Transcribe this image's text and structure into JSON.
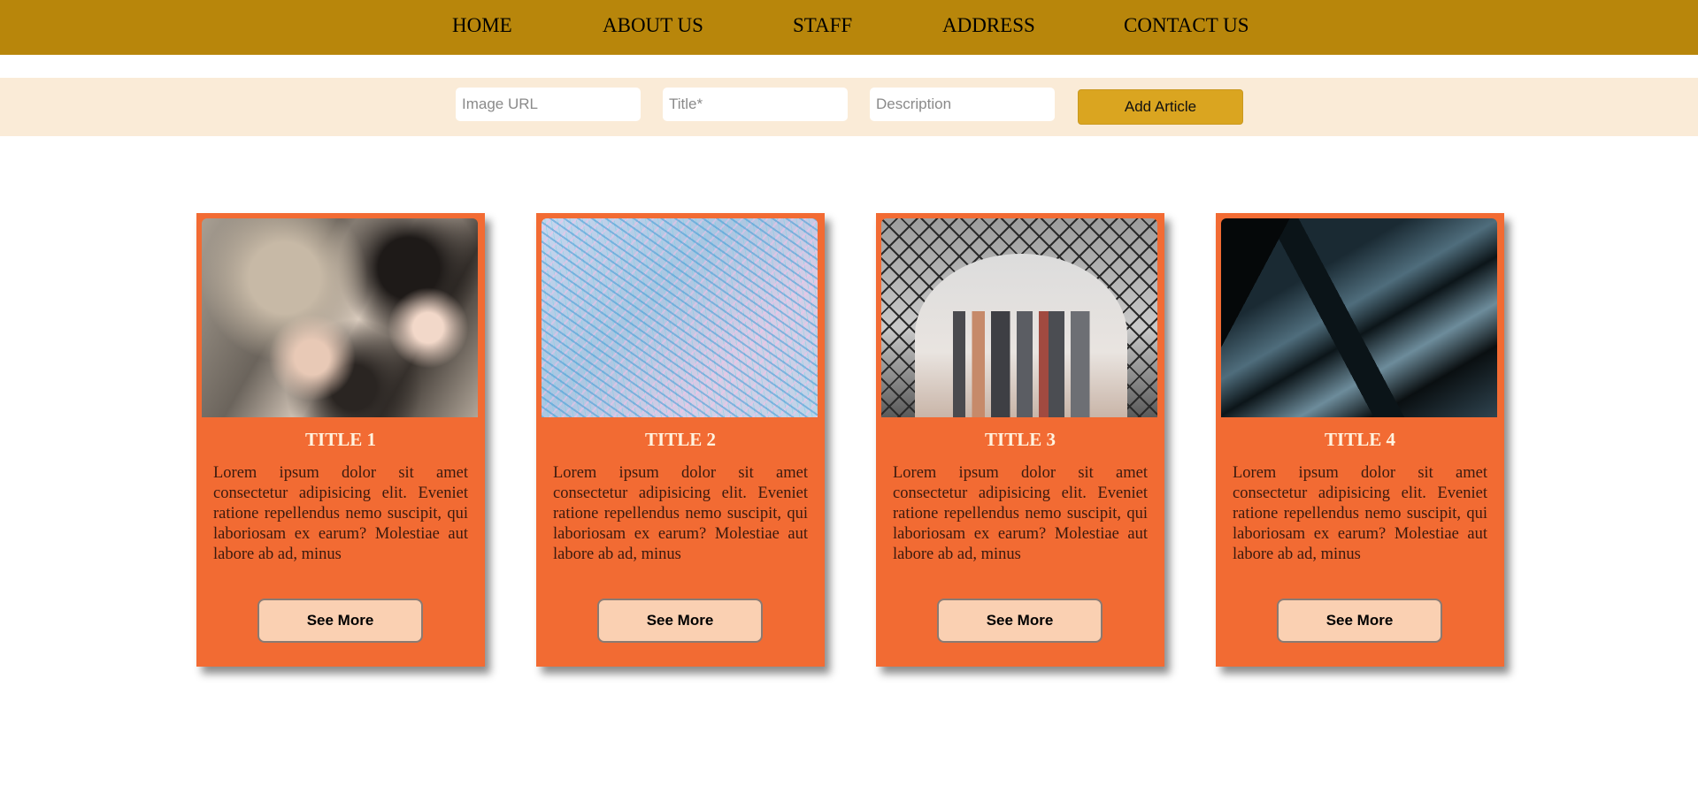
{
  "nav": {
    "items": [
      "HOME",
      "ABOUT US",
      "STAFF",
      "ADDRESS",
      "CONTACT US"
    ]
  },
  "form": {
    "image_url_placeholder": "Image URL",
    "title_placeholder": "Title*",
    "description_placeholder": "Description",
    "submit_label": "Add Article"
  },
  "cards": [
    {
      "title": "TITLE 1",
      "text": "Lorem ipsum dolor sit amet consectetur adipisicing elit. Eveniet ratione repellendus nemo suscipit, qui laboriosam ex earum? Molestiae aut labore ab ad, minus",
      "button": "See More"
    },
    {
      "title": "TITLE 2",
      "text": "Lorem ipsum dolor sit amet consectetur adipisicing elit. Eveniet ratione repellendus nemo suscipit, qui laboriosam ex earum? Molestiae aut labore ab ad, minus",
      "button": "See More"
    },
    {
      "title": "TITLE 3",
      "text": "Lorem ipsum dolor sit amet consectetur adipisicing elit. Eveniet ratione repellendus nemo suscipit, qui laboriosam ex earum? Molestiae aut labore ab ad, minus",
      "button": "See More"
    },
    {
      "title": "TITLE 4",
      "text": "Lorem ipsum dolor sit amet consectetur adipisicing elit. Eveniet ratione repellendus nemo suscipit, qui laboriosam ex earum? Molestiae aut labore ab ad, minus",
      "button": "See More"
    }
  ],
  "colors": {
    "nav_background": "#b8860b",
    "form_background": "#faebd7",
    "add_button": "#daa520",
    "card_background": "#f26b33",
    "card_title": "#fff3df",
    "see_more_button": "#fad0b2"
  }
}
